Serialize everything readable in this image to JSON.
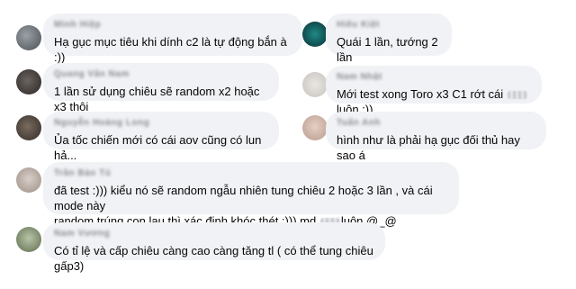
{
  "comments": [
    {
      "author": "Minh Hiệp",
      "text": "Hạ gục mục tiêu khi dính c2 là tự động bắn à :))"
    },
    {
      "author": "Hiếu Kiệt",
      "text": "Quái 1 lần, tướng 2 lần"
    },
    {
      "author": "Quang Văn Nam",
      "text": "1 lần sử dụng chiêu sẽ random x2 hoặc x3 thôi"
    },
    {
      "author": "Nam Nhật",
      "text_before": "Mới test xong Toro x3 C1 rớt cái",
      "text_after": "luôn :))"
    },
    {
      "author": "Nguyễn Hoàng Long",
      "text": "Ủa tốc chiến mới có cái aov cũng có lun hả..."
    },
    {
      "author": "Tuấn Anh",
      "text": "hình như là phải hạ gục đối thủ hay sao á"
    },
    {
      "author": "Trần Bảo Tú",
      "text_before": "đã test :))) kiểu nó sẽ random ngẫu nhiên tung chiêu 2 hoặc 3 lần , và cái mode này\nrandom trúng con lau thì xác định khóc thét :))) md",
      "text_after": "luôn @_@"
    },
    {
      "author": "Nam Vương",
      "text": "Có tỉ lệ và cấp chiêu càng cao càng tăng tl ( có thể tung chiêu gấp3)"
    }
  ]
}
